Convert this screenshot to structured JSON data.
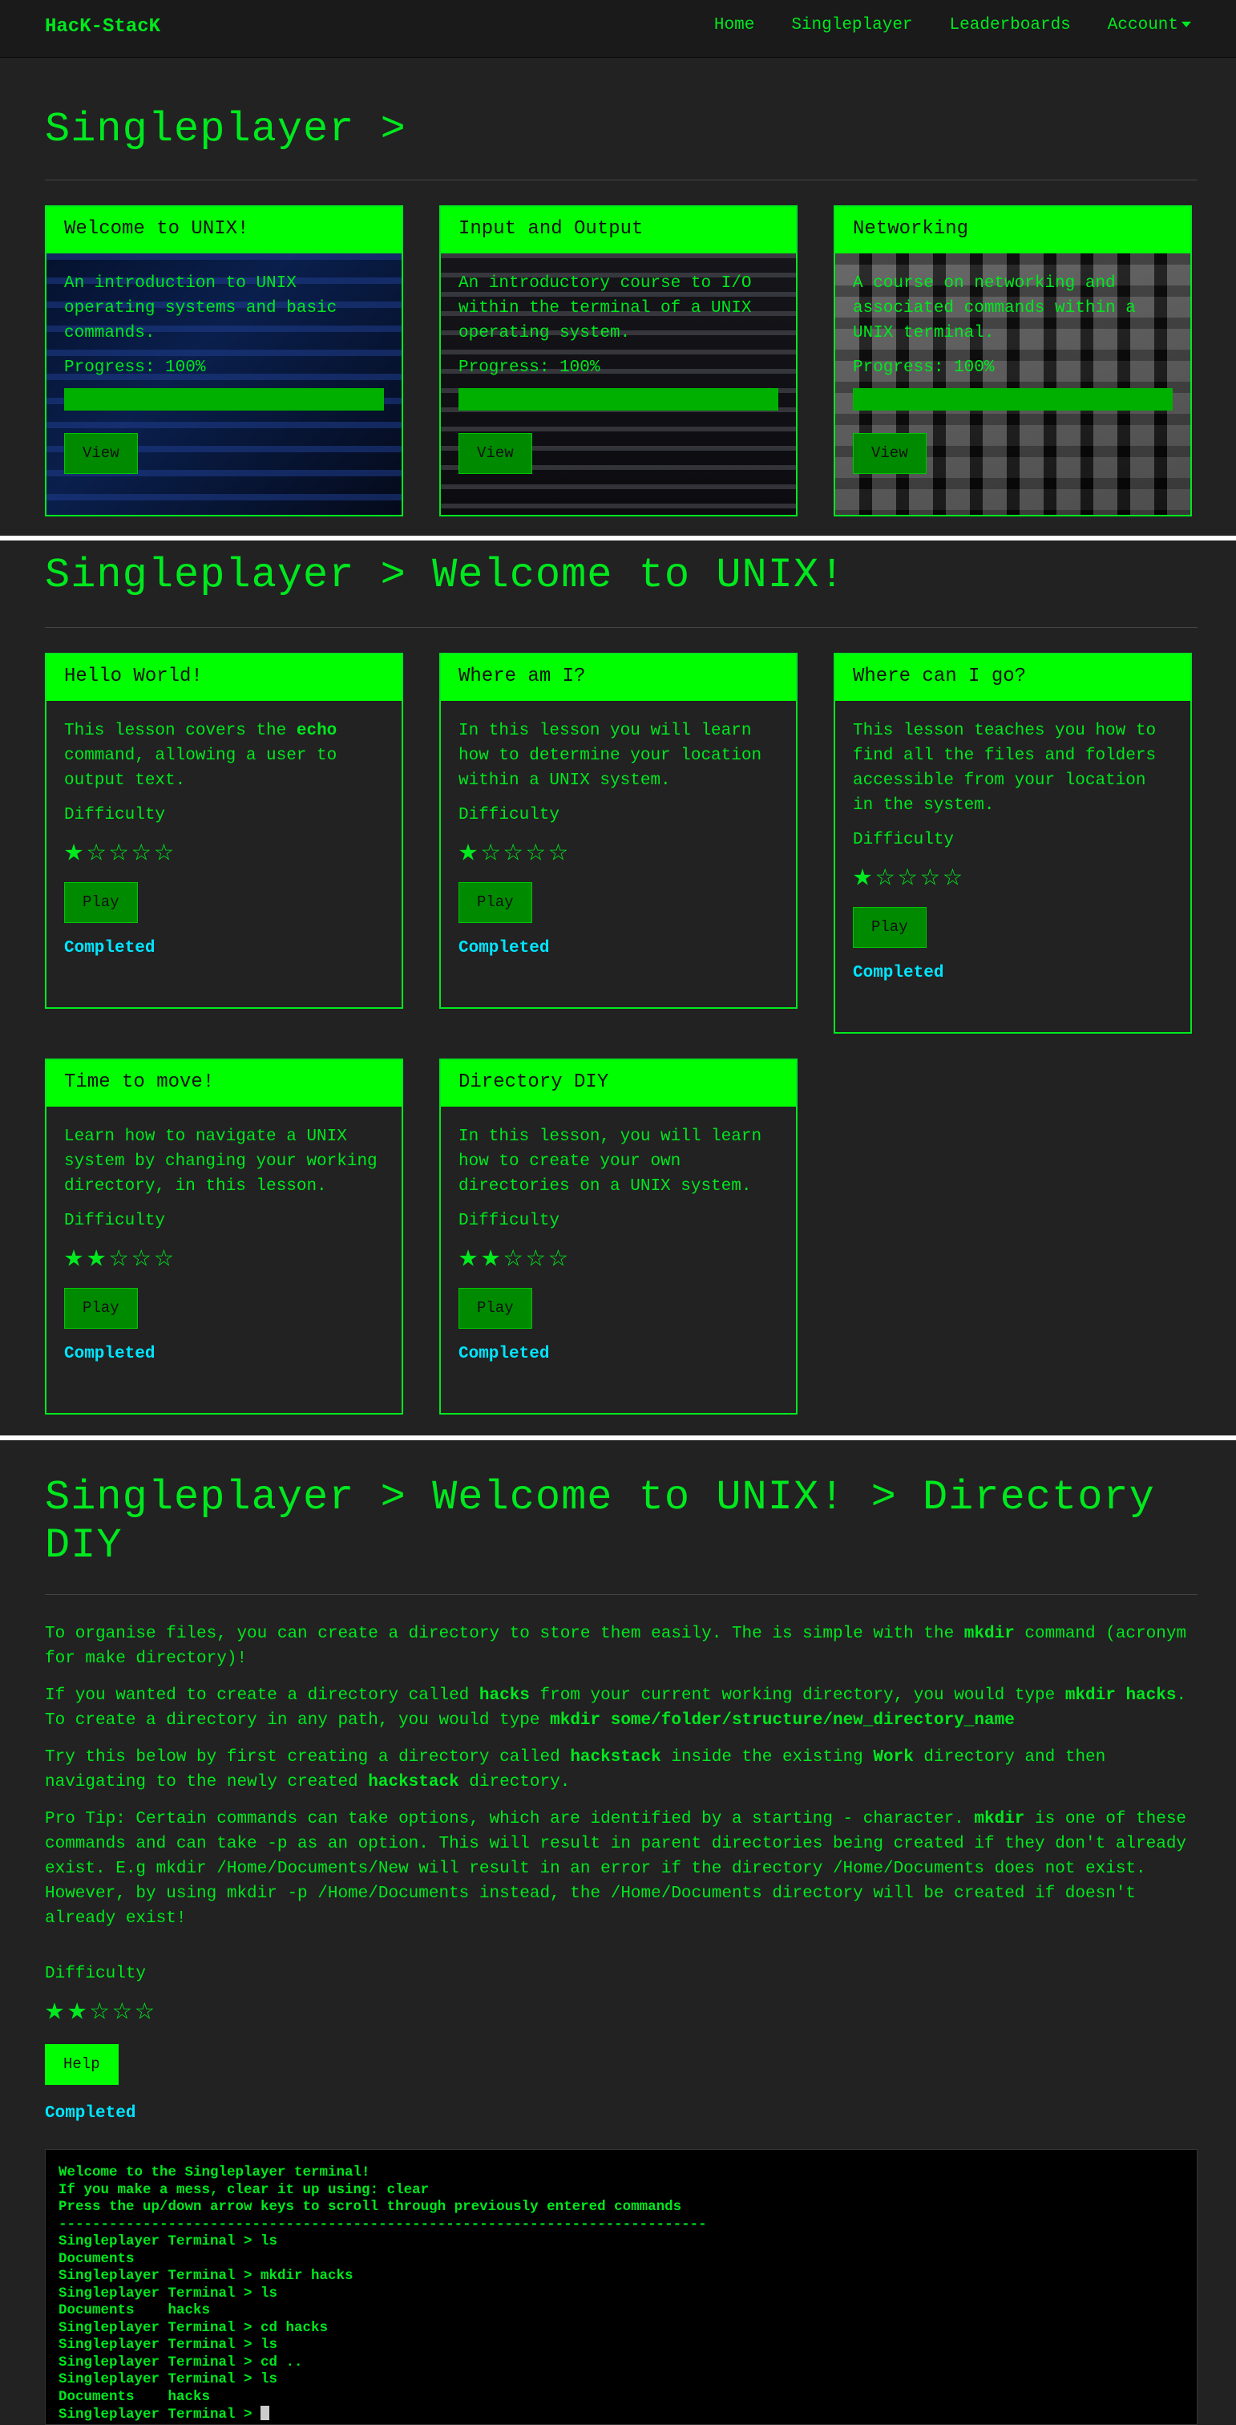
{
  "nav": {
    "brand": "HacK-StacK",
    "items": [
      "Home",
      "Singleplayer",
      "Leaderboards",
      "Account"
    ]
  },
  "section1": {
    "title": "Singleplayer >",
    "courses": [
      {
        "title": "Welcome to UNIX!",
        "description": "An introduction to UNIX operating systems and basic commands.",
        "progress_label": "Progress: 100%",
        "progress": 1.0,
        "button": "View"
      },
      {
        "title": "Input and Output",
        "description": "An introductory course to I/O within the terminal of a UNIX operating system.",
        "progress_label": "Progress: 100%",
        "progress": 1.0,
        "button": "View"
      },
      {
        "title": "Networking",
        "description": "A course on networking and associated commands within a UNIX terminal.",
        "progress_label": "Progress: 100%",
        "progress": 1.0,
        "button": "View"
      }
    ]
  },
  "section2": {
    "title": "Singleplayer > Welcome to UNIX!",
    "difficulty_label": "Difficulty",
    "play_label": "Play",
    "completed_label": "Completed",
    "lessons": [
      {
        "title": "Hello World!",
        "description_pre": "This lesson covers the ",
        "description_bold": "echo",
        "description_post": " command, allowing a user to output text.",
        "difficulty": 1
      },
      {
        "title": "Where am I?",
        "description": "In this lesson you will learn how to determine your location within a UNIX system.",
        "difficulty": 1
      },
      {
        "title": "Where can I go?",
        "description": "This lesson teaches you how to find all the files and folders accessible from your location in the system.",
        "difficulty": 1
      },
      {
        "title": "Time to move!",
        "description": "Learn how to navigate a UNIX system by changing your working directory, in this lesson.",
        "difficulty": 2
      },
      {
        "title": "Directory DIY",
        "description": "In this lesson, you will learn how to create your own directories on a UNIX system.",
        "difficulty": 2
      }
    ]
  },
  "section3": {
    "title": "Singleplayer > Welcome to UNIX! > Directory DIY",
    "p1_a": "To organise files, you can create a directory to store them easily. The is simple with the ",
    "p1_b": "mkdir",
    "p1_c": " command (acronym for make directory)!",
    "p2_a": "If you wanted to create a directory called ",
    "p2_b": "hacks",
    "p2_c": " from your current working directory, you would type ",
    "p2_d": "mkdir hacks",
    "p2_e": ". To create a directory in any path, you would type ",
    "p2_f": "mkdir some/folder/structure/new_directory_name",
    "p3_a": "Try this below by first creating a directory called ",
    "p3_b": "hackstack",
    "p3_c": " inside the existing ",
    "p3_d": "Work",
    "p3_e": " directory and then navigating to the newly created ",
    "p3_f": "hackstack",
    "p3_g": " directory.",
    "p4_a": "Pro Tip: Certain commands can take options, which are identified by a starting - character. ",
    "p4_b": "mkdir",
    "p4_c": " is one of these commands and can take -p as an option. This will result in parent directories being created if they don't already exist. E.g mkdir /Home/Documents/New will result in an error if the directory /Home/Documents does not exist. However, by using mkdir -p /Home/Documents instead, the /Home/Documents directory will be created if doesn't already exist!",
    "difficulty_label": "Difficulty",
    "difficulty": 2,
    "help_label": "Help",
    "completed_label": "Completed",
    "terminal_lines": [
      "Welcome to the Singleplayer terminal!",
      "If you make a mess, clear it up using: clear",
      "Press the up/down arrow keys to scroll through previously entered commands",
      "-----------------------------------------------------------------------------",
      "Singleplayer Terminal > ls",
      "Documents",
      "Singleplayer Terminal > mkdir hacks",
      "Singleplayer Terminal > ls",
      "Documents    hacks",
      "Singleplayer Terminal > cd hacks",
      "Singleplayer Terminal > ls",
      "Singleplayer Terminal > cd ..",
      "Singleplayer Terminal > ls",
      "Documents    hacks"
    ],
    "terminal_prompt": "Singleplayer Terminal > "
  },
  "colors": {
    "accent": "#00ff00",
    "text": "#00e81e",
    "completed": "#00e5ff",
    "background": "#222222"
  },
  "icons": {
    "star_filled": "★",
    "star_empty": "☆"
  }
}
